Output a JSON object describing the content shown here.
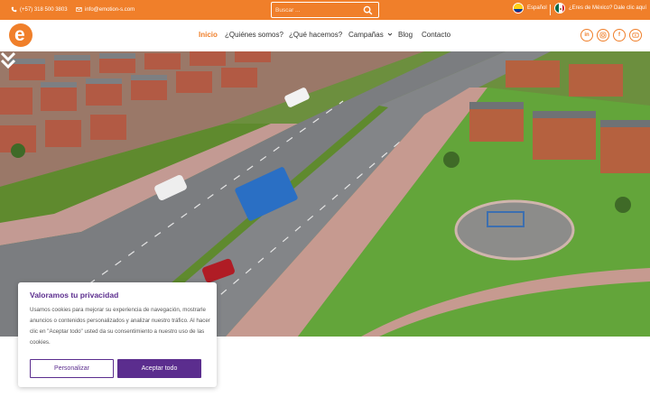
{
  "topbar": {
    "phone": "(+57) 318 500 3803",
    "email": "info@emotion-s.com",
    "search_placeholder": "Buscar ...",
    "language": "Español",
    "mexico_prompt": "¿Eres de México? Dale clic aquí"
  },
  "nav": {
    "logo_letter": "e",
    "items": [
      "Inicio",
      "¿Quiénes somos?",
      "¿Qué hacemos?",
      "Campañas",
      "Blog",
      "Contacto"
    ],
    "active_item": "Inicio",
    "social": [
      "linkedin-icon",
      "instagram-icon",
      "facebook-icon",
      "youtube-icon"
    ]
  },
  "hero": {
    "icon": "chevron-double-down-icon"
  },
  "cookie": {
    "title": "Valoramos tu privacidad",
    "text": "Usamos cookies para mejorar su experiencia de navegación, mostrarle anuncios o contenidos personalizados y analizar nuestro tráfico. Al hacer clic en \"Aceptar todo\" usted da su consentimiento a nuestro uso de las cookies.",
    "customize_label": "Personalizar",
    "accept_label": "Aceptar todo"
  },
  "colors": {
    "brand_orange": "#f07f2a",
    "brand_purple": "#5b2d8e"
  }
}
